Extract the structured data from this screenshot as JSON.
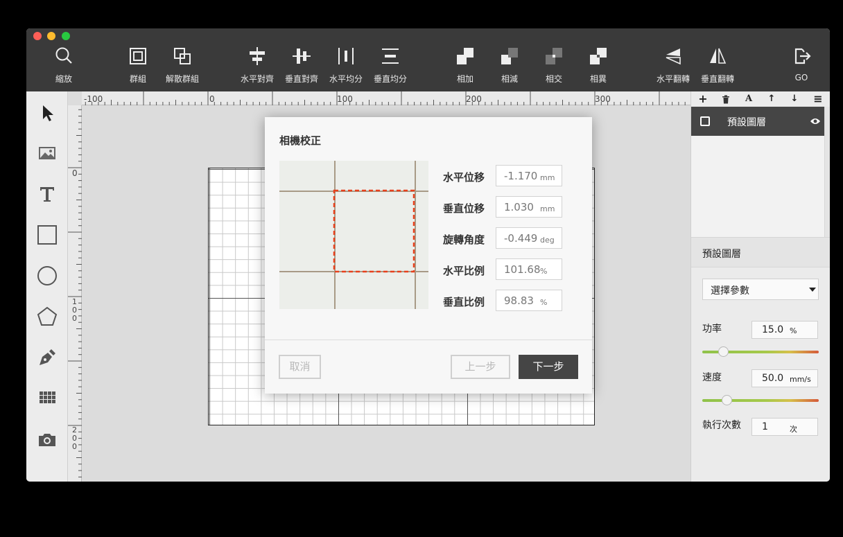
{
  "toolbar": {
    "items": [
      {
        "label": "縮放",
        "icon": "zoom-icon"
      },
      {
        "label": "群組",
        "icon": "group-icon"
      },
      {
        "label": "解散群組",
        "icon": "ungroup-icon"
      },
      {
        "label": "水平對齊",
        "icon": "align-horizontal-icon"
      },
      {
        "label": "垂直對齊",
        "icon": "align-vertical-icon"
      },
      {
        "label": "水平均分",
        "icon": "distribute-horizontal-icon"
      },
      {
        "label": "垂直均分",
        "icon": "distribute-vertical-icon"
      },
      {
        "label": "相加",
        "icon": "union-icon"
      },
      {
        "label": "相減",
        "icon": "subtract-icon"
      },
      {
        "label": "相交",
        "icon": "intersect-icon"
      },
      {
        "label": "相異",
        "icon": "difference-icon"
      },
      {
        "label": "水平翻轉",
        "icon": "flip-horizontal-icon"
      },
      {
        "label": "垂直翻轉",
        "icon": "flip-vertical-icon"
      },
      {
        "label": "GO",
        "icon": "go-icon"
      }
    ]
  },
  "left_tools": [
    "cursor-icon",
    "image-icon",
    "text-icon",
    "rectangle-icon",
    "ellipse-icon",
    "polygon-icon",
    "pen-icon",
    "grid-array-icon",
    "camera-icon"
  ],
  "rulers": {
    "h": [
      "-100",
      "0",
      "100",
      "200",
      "300"
    ],
    "v": [
      "0",
      "1\n0\n0",
      "2\n0\n0"
    ]
  },
  "layers": {
    "toolbar_glyphs": {
      "add": "+",
      "text": "A",
      "up": "↑",
      "down": "↓",
      "menu": "≡"
    },
    "items": [
      {
        "name": "預設圖層"
      }
    ]
  },
  "params": {
    "layer_title": "預設圖層",
    "preset_select": "選擇參數",
    "power_label": "功率",
    "power_value": "15.0",
    "power_unit": "%",
    "power_fraction": 0.15,
    "speed_label": "速度",
    "speed_value": "50.0",
    "speed_unit": "mm/s",
    "speed_fraction": 0.18,
    "repeat_label": "執行次數",
    "repeat_value": "1",
    "repeat_unit": "次"
  },
  "dialog": {
    "title": "相機校正",
    "fields": [
      {
        "label": "水平位移",
        "value": "-1.170",
        "unit": "mm"
      },
      {
        "label": "垂直位移",
        "value": "1.030",
        "unit": "mm"
      },
      {
        "label": "旋轉角度",
        "value": "-0.449",
        "unit": "deg"
      },
      {
        "label": "水平比例",
        "value": "101.68",
        "unit": "%"
      },
      {
        "label": "垂直比例",
        "value": "98.83",
        "unit": "%"
      }
    ],
    "cancel_label": "取消",
    "back_label": "上一步",
    "next_label": "下一步"
  },
  "colors": {
    "accent_dark": "#454545",
    "dash_red": "#e8401c"
  }
}
